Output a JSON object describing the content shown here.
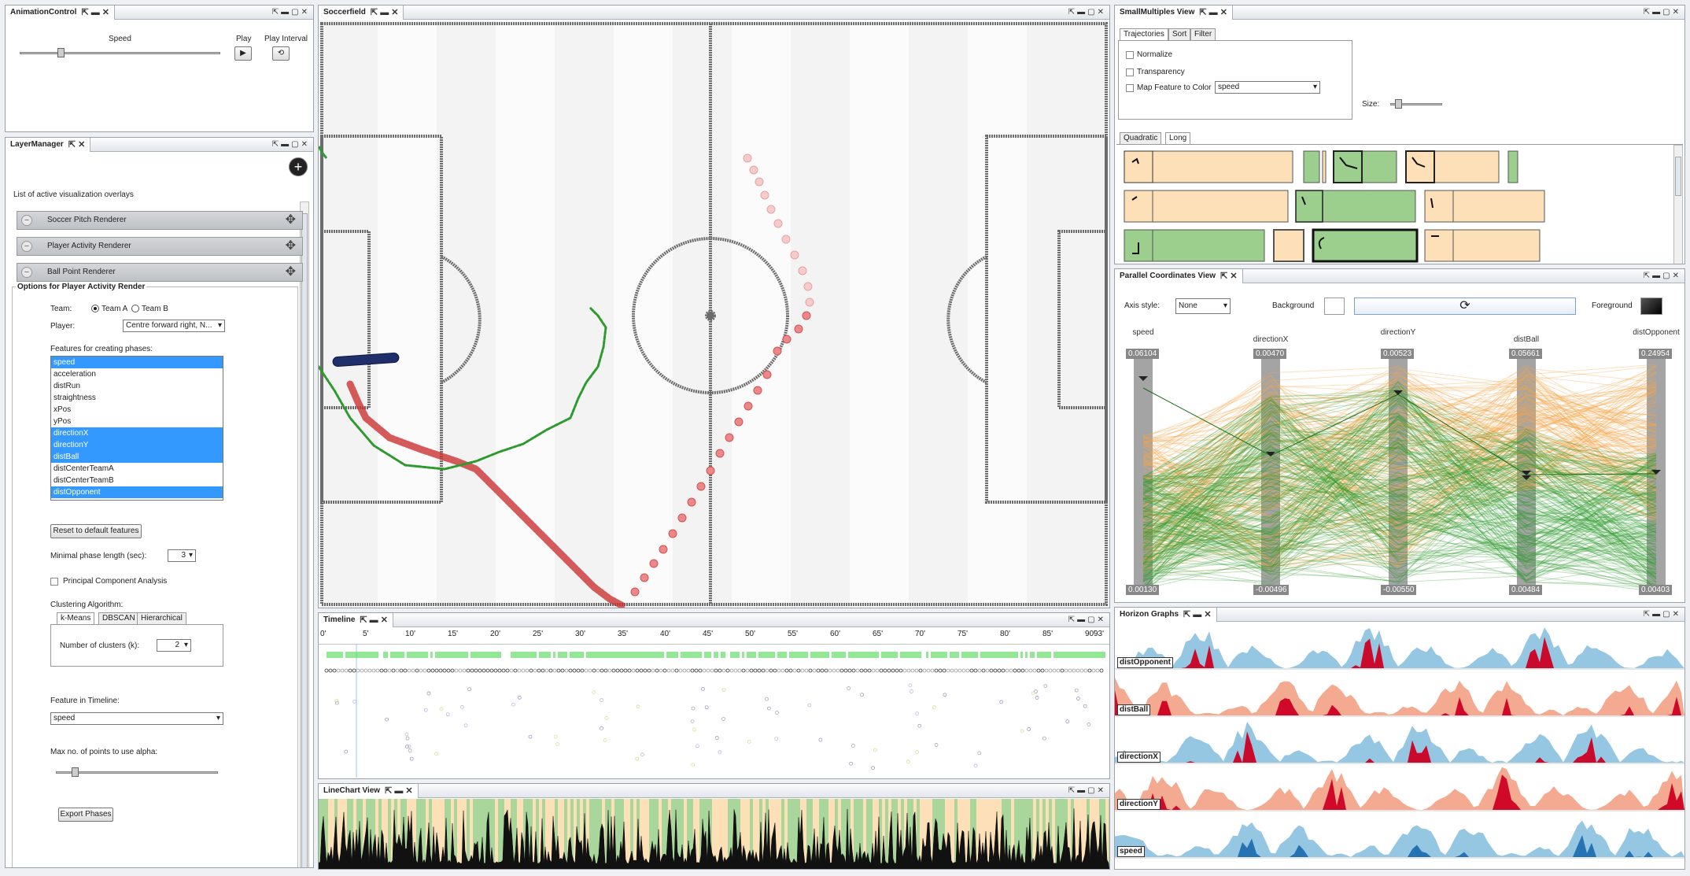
{
  "windows": {
    "animation": "AnimationControl",
    "layer": "LayerManager",
    "soccer": "Soccerfield",
    "small": "SmallMultiples View",
    "parallel": "Parallel Coordinates View",
    "timeline": "Timeline",
    "linechart": "LineChart View",
    "horizon": "Horizon Graphs"
  },
  "animation": {
    "speed_label": "Speed",
    "play_label": "Play",
    "play_interval_label": "Play Interval"
  },
  "layers": {
    "heading": "List of active visualization overlays",
    "items": [
      "Soccer Pitch Renderer",
      "Player Activity Renderer",
      "Ball Point Renderer"
    ]
  },
  "options": {
    "heading": "Options for Player Activity Render",
    "team_label": "Team:",
    "team_a": "Team A",
    "team_b": "Team B",
    "player_label": "Player:",
    "player_value": "Centre forward right, N...",
    "features_label": "Features for creating phases:",
    "features": [
      {
        "name": "speed",
        "selected": true
      },
      {
        "name": "acceleration",
        "selected": false
      },
      {
        "name": "distRun",
        "selected": false
      },
      {
        "name": "straightness",
        "selected": false
      },
      {
        "name": "xPos",
        "selected": false
      },
      {
        "name": "yPos",
        "selected": false
      },
      {
        "name": "directionX",
        "selected": true
      },
      {
        "name": "directionY",
        "selected": true
      },
      {
        "name": "distBall",
        "selected": true
      },
      {
        "name": "distCenterTeamA",
        "selected": false
      },
      {
        "name": "distCenterTeamB",
        "selected": false
      },
      {
        "name": "distOpponent",
        "selected": true
      }
    ],
    "reset_button": "Reset to default features",
    "min_phase_label": "Minimal phase length (sec):",
    "min_phase_value": "3",
    "pca_label": "Principal Component Analysis",
    "clustering_label": "Clustering Algorithm:",
    "cluster_tabs": [
      "k-Means",
      "DBSCAN",
      "Hierarchical"
    ],
    "num_clusters_label": "Number of clusters (k):",
    "num_clusters_value": "2",
    "timeline_feature_label": "Feature in Timeline:",
    "timeline_feature_value": "speed",
    "max_points_label": "Max no. of points to use alpha:",
    "export_button": "Export Phases"
  },
  "small": {
    "tabs": [
      "Trajectories",
      "Sort",
      "Filter"
    ],
    "normalize": "Normalize",
    "transparency": "Transparency",
    "map_feature": "Map Feature to Color",
    "map_feature_value": "speed",
    "size_label": "Size:",
    "layout_tabs": [
      "Quadratic",
      "Long"
    ]
  },
  "parallel": {
    "axis_style_label": "Axis style:",
    "axis_style_value": "None",
    "background_label": "Background",
    "foreground_label": "Foreground",
    "axes": [
      {
        "name": "speed",
        "max": "0.06104",
        "min": "0.00130"
      },
      {
        "name": "directionX",
        "max": "0.00470",
        "min": "-0.00496"
      },
      {
        "name": "directionY",
        "max": "0.00523",
        "min": "-0.00550"
      },
      {
        "name": "distBall",
        "max": "0.05661",
        "min": "0.00484"
      },
      {
        "name": "distOpponent",
        "max": "0.24954",
        "min": "0.00403"
      }
    ]
  },
  "timeline": {
    "ticks": [
      "0'",
      "5'",
      "10'",
      "15'",
      "20'",
      "25'",
      "30'",
      "35'",
      "40'",
      "45'",
      "50'",
      "55'",
      "60'",
      "65'",
      "70'",
      "75'",
      "80'",
      "85'",
      "90'",
      "93'"
    ]
  },
  "horizon": {
    "rows": [
      "distOpponent",
      "distBall",
      "directionX",
      "directionY",
      "speed"
    ]
  },
  "colors": {
    "green": "#2e9a2e",
    "orange": "#f5a54a",
    "red": "#d33",
    "navy": "#1f2f6b",
    "peach": "#fde0b8",
    "lightgreen": "#9ccf8d",
    "hz_orange": "#f2a58a",
    "hz_red": "#cc0022",
    "hz_blue": "#8fc3e0",
    "hz_darkblue": "#1f6fb0"
  }
}
